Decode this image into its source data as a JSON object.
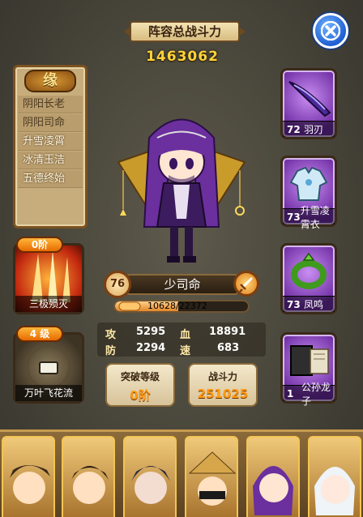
{
  "header": {
    "title": "阵容总战斗力",
    "total_power": "1463062"
  },
  "close": {
    "icon": "close-icon"
  },
  "fate": {
    "badge": "缘",
    "items": [
      {
        "label": "阴阳长老",
        "active": false
      },
      {
        "label": "阴阳司命",
        "active": false
      },
      {
        "label": "升雪凌霄",
        "active": true
      },
      {
        "label": "冰清玉洁",
        "active": true
      },
      {
        "label": "五德终始",
        "active": true
      }
    ]
  },
  "hero": {
    "level": "76",
    "name": "少司命",
    "exp_text": "10628/22372",
    "exp_fraction": 0.475
  },
  "stats": {
    "attack_label": "攻",
    "attack": "5295",
    "hp_label": "血",
    "hp": "18891",
    "defense_label": "防",
    "defense": "2294",
    "speed_label": "速",
    "speed": "683"
  },
  "breakthrough": {
    "title": "突破等级",
    "value": "0阶"
  },
  "power": {
    "title": "战斗力",
    "value": "251025"
  },
  "skills": [
    {
      "cap": "0阶",
      "name": "三极殒灭"
    },
    {
      "cap": "4 级",
      "name": "万叶飞花流"
    }
  ],
  "equipment": [
    {
      "level": "72",
      "name": "羽刃",
      "icon": "dagger-icon"
    },
    {
      "level": "73",
      "name": "升雪凌霄衣",
      "icon": "armor-icon"
    },
    {
      "level": "73",
      "name": "凤鸣",
      "icon": "jade-ring-icon"
    },
    {
      "level": "1",
      "name": "公孙龙子",
      "icon": "book-icon"
    }
  ],
  "roster_count": 6
}
